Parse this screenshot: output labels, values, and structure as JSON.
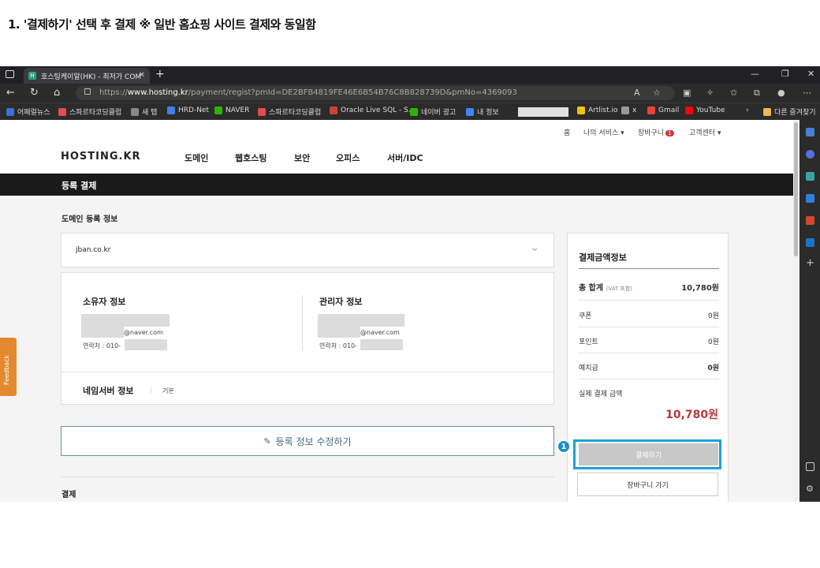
{
  "caption": "1. '결제하기' 선택 후 결제   ※ 일반 홈쇼핑 사이트 결제와 동일함",
  "browser": {
    "tab_title": "호스팅케이알(HK) - 최저가 COM",
    "url_prefix": "https://",
    "url_domain": "www.hosting.kr",
    "url_path": "/payment/regist?pmId=DE2BFB4819FE46E6B54B76C8B828739D&pmNo=4369093",
    "bookmarks": [
      {
        "label": "어페럴뉴스",
        "color": "#3c6fd8"
      },
      {
        "label": "스파르타코딩클럽",
        "color": "#e24d4d"
      },
      {
        "label": "새 탭",
        "color": "#888"
      },
      {
        "label": "HRD-Net",
        "color": "#3a84e0"
      },
      {
        "label": "NAVER",
        "color": "#2db400"
      },
      {
        "label": "스파르타코딩클럽",
        "color": "#e24d4d"
      },
      {
        "label": "Oracle Live SQL - S...",
        "color": "#c74634"
      },
      {
        "label": "네이버 광고",
        "color": "#2db400"
      },
      {
        "label": "내 정보",
        "color": "#4285f4"
      },
      {
        "label": "Artlist.io",
        "color": "#f2c200"
      },
      {
        "label": "x",
        "color": "#999"
      },
      {
        "label": "Gmail",
        "color": "#ea4335"
      },
      {
        "label": "YouTube",
        "color": "#ff0000"
      }
    ],
    "other_bookmarks": "다른 즐겨찾기"
  },
  "header": {
    "util": [
      "홈",
      "나의 서비스 ▾",
      "장바구니",
      "고객센터 ▾"
    ],
    "cart_count": "1",
    "logo": "HOSTING.KR",
    "gnb": [
      "도메인",
      "웹호스팅",
      "보안",
      "오피스",
      "서버/IDC"
    ]
  },
  "page_title": "등록 결제",
  "domain_section": {
    "title": "도메인 등록 정보",
    "domain": "jban.co.kr"
  },
  "owner": {
    "title": "소유자 정보",
    "email_suffix": "@naver.com",
    "phone_prefix": "연락처 : 010-"
  },
  "admin": {
    "title": "관리자 정보",
    "email_suffix": "@naver.com",
    "phone_prefix": "연락처 : 010-"
  },
  "nameserver": {
    "title": "네임서버 정보",
    "value": "기본"
  },
  "edit_button": "등록 정보 수정하기",
  "payment_title": "결제",
  "summary": {
    "title": "결제금액정보",
    "total_label": "총 합계",
    "vat_note": "(VAT 포함)",
    "total_value": "10,780원",
    "coupon_label": "쿠폰",
    "coupon_value": "0원",
    "point_label": "포인트",
    "point_value": "0원",
    "deposit_label": "예치금",
    "deposit_value": "0원",
    "actual_label": "실제 결제 금액",
    "actual_value": "10,780원",
    "pay_button": "결제하기",
    "cart_button": "장바구니 가기"
  },
  "step_number": "1",
  "feedback": "Feedback",
  "colors": {
    "highlight": "#1ba1d6",
    "price_red": "#b53a3a",
    "dark_bar": "#1a1a1a"
  }
}
